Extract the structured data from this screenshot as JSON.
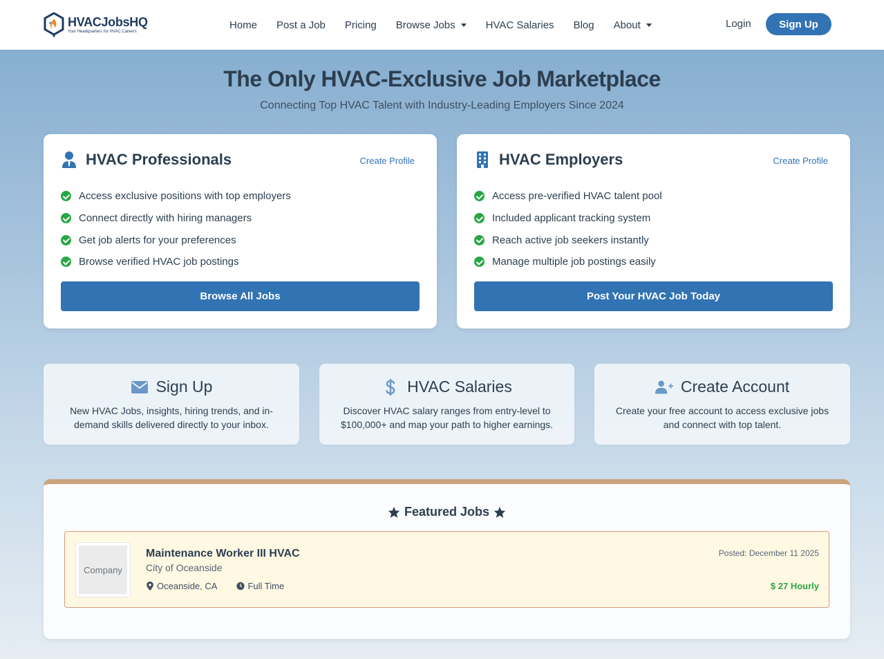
{
  "brand": {
    "name": "HVACJobsHQ",
    "tagline": "Your Headquarters for HVAC Careers"
  },
  "nav": {
    "items": [
      {
        "label": "Home"
      },
      {
        "label": "Post a Job"
      },
      {
        "label": "Pricing"
      },
      {
        "label": "Browse Jobs"
      },
      {
        "label": "HVAC Salaries"
      },
      {
        "label": "Blog"
      },
      {
        "label": "About"
      }
    ],
    "login": "Login",
    "signup": "Sign Up"
  },
  "hero": {
    "title": "The Only HVAC-Exclusive Job Marketplace",
    "subtitle": "Connecting Top HVAC Talent with Industry-Leading Employers Since 2024"
  },
  "professionals": {
    "icon": "user-tie-icon",
    "title": "HVAC Professionals",
    "link": "Create Profile",
    "features": [
      "Access exclusive positions with top employers",
      "Connect directly with hiring managers",
      "Get job alerts for your preferences",
      "Browse verified HVAC job postings"
    ],
    "button": "Browse All Jobs"
  },
  "employers": {
    "icon": "building-icon",
    "title": "HVAC Employers",
    "link": "Create Profile",
    "features": [
      "Access pre-verified HVAC talent pool",
      "Included applicant tracking system",
      "Reach active job seekers instantly",
      "Manage multiple job postings easily"
    ],
    "button": "Post Your HVAC Job Today"
  },
  "mini_cards": [
    {
      "icon": "envelope-icon",
      "title": "Sign Up",
      "text": "New HVAC Jobs, insights, hiring trends, and in-demand skills delivered directly to your inbox."
    },
    {
      "icon": "dollar-icon",
      "title": "HVAC Salaries",
      "text": "Discover HVAC salary ranges from entry-level to $100,000+ and map your path to higher earnings."
    },
    {
      "icon": "user-plus-icon",
      "title": "Create Account",
      "text": "Create your free account to access exclusive jobs and connect with top talent."
    }
  ],
  "featured": {
    "title": "Featured Jobs",
    "jobs": [
      {
        "logo_text": "Company",
        "title": "Maintenance Worker III HVAC",
        "company": "City of Oceanside",
        "location": "Oceanside, CA",
        "type": "Full Time",
        "posted": "Posted: December 11 2025",
        "pay": "$ 27 Hourly"
      }
    ]
  },
  "colors": {
    "primary": "#3273b3",
    "success": "#28a745",
    "text": "#2c3e50",
    "featured_border": "#c9a27e",
    "job_bg": "#fff8e3"
  }
}
